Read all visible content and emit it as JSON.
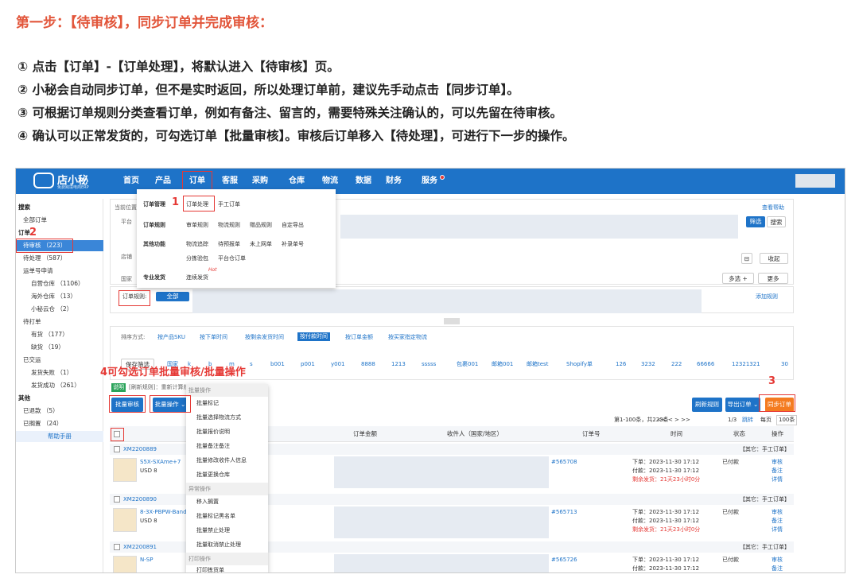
{
  "doc": {
    "title": "第一步：【待审核】，同步订单并完成审核：",
    "steps": [
      "① 点击【订单】-【订单处理】，将默认进入【待审核】页。",
      "② 小秘会自动同步订单，但不是实时返回，所以处理订单前，建议先手动点击【同步订单】。",
      "③ 可根据订单规则分类查看订单，例如有备注、留言的，需要特殊关注确认的，可以先留在待审核。",
      "④ 确认可以正常发货的，可勾选订单【批量审核】。审核后订单移入【待处理】，可进行下一步的操作。"
    ]
  },
  "app": {
    "logo_name": "店小秘",
    "logo_sub": "免费跨境电商ERP",
    "nav": [
      "首页",
      "产品",
      "订单",
      "客服",
      "采购",
      "仓库",
      "物流",
      "数据",
      "财务",
      "服务"
    ],
    "help_link": "查看帮助"
  },
  "sidebar": {
    "search": "搜索",
    "all_orders": "全部订单",
    "orders_head": "订单",
    "pending_review": "待审核 （223）",
    "pending_process": "待处理 （587）",
    "tracking_apply": "运单号申请",
    "own_wh": "自营仓库 （1106）",
    "overseas_wh": "海外仓库 （13）",
    "xiaomi_wh": "小秘云仓 （2）",
    "to_print": "待打单",
    "in_stock": "有货 （177）",
    "out_of_stock": "缺货 （19）",
    "shipped": "已交运",
    "ship_failed": "发货失败 （1）",
    "ship_success": "发货成功 （261）",
    "other_head": "其他",
    "refunded": "已退款 （5）",
    "on_hold": "已搁置 （24）",
    "help_manual": "帮助手册"
  },
  "dropdown": {
    "order_mgmt": "订单管理",
    "order_process": "订单处理",
    "manual_order": "手工订单",
    "order_rules": "订单规则",
    "rules": [
      "审单规则",
      "物流规则",
      "赠品规则",
      "自定导出"
    ],
    "other_funcs": "其他功能",
    "funcs": [
      "物流追踪",
      "待预报单",
      "未上网单",
      "补录单号",
      "分拣验包",
      "平台仓订单"
    ],
    "pro_ship": "专业发货",
    "continuous_ship": "连续发货",
    "hot": "Hot"
  },
  "filters": {
    "current_pos": "当前位置",
    "platform": "平台",
    "shop": "店铺",
    "country": "国家",
    "order_rule_label": "订单规则:",
    "order_rule_all": "全部 （223）",
    "add_rule": "添加规则",
    "filter_btn": "筛选",
    "search_btn": "搜索",
    "collapse": "收起",
    "multi_select": "多选 +",
    "more": "更多",
    "sort_label": "排序方式:",
    "sorts": [
      "按产品SKU",
      "按下单时间",
      "按剩余发货时间",
      "按付款时间",
      "按订单金额",
      "按买家指定物流"
    ],
    "save_filter": "保存筛选",
    "tags": [
      "国家",
      "k",
      "b",
      "m",
      "s",
      "b001",
      "p001",
      "y001",
      "8888",
      "1213",
      "sssss",
      "包裹001",
      "邮箱001",
      "邮箱test",
      "Shopify单",
      "126",
      "3232",
      "222",
      "66666",
      "12321321",
      "30"
    ],
    "notice_tag": "说明",
    "notice_text": "[刷新规则]：重新计算规则，并自动归入相应规则内"
  },
  "actions": {
    "bulk_review": "批量审核",
    "bulk_ops": "批量操作",
    "refresh_rules": "刷新规则",
    "export_orders": "导出订单",
    "sync_orders": "同步订单",
    "pagination": "第1-100条，共223条",
    "page_info": "1/3",
    "jump": "跳转",
    "per_page": "每页",
    "per_page_val": "100条"
  },
  "bulk_menu": {
    "g1": "批量操作",
    "g1_items": [
      "批量标记",
      "批量选择物流方式",
      "批量报价说明",
      "批量备注备注",
      "批量修改收件人信息",
      "批量更换仓库"
    ],
    "g2": "异常操作",
    "g2_items": [
      "移入搁置",
      "批量标记黑名单",
      "批量禁止处理",
      "批量取消禁止处理"
    ],
    "g3": "打印操作",
    "g3_items": [
      "打印拣货单"
    ]
  },
  "table": {
    "headers": [
      "订单金额",
      "收件人（国家/地区）",
      "订单号",
      "时间",
      "状态",
      "操作"
    ],
    "order_type": "【其它：手工订单】",
    "rows": [
      {
        "id": "XM2200889",
        "sku": "S5X-SXAme+7",
        "qty": "x",
        "price": "USD 8",
        "order_no": "#565708",
        "t1": "下单：2023-11-30 17:12",
        "t2": "付款：2023-11-30 17:12",
        "t3": "剩余发货：21天23小时0分",
        "status": "已付款",
        "ops": [
          "审核",
          "备注",
          "详情"
        ]
      },
      {
        "id": "XM2200890",
        "sku": "8-3X-PBPW-Band",
        "qty": "",
        "price": "USD 8",
        "order_no": "#565713",
        "t1": "下单：2023-11-30 17:12",
        "t2": "付款：2023-11-30 17:12",
        "t3": "剩余发货：21天23小时0分",
        "status": "已付款",
        "ops": [
          "审核",
          "备注",
          "详情"
        ]
      },
      {
        "id": "XM2200891",
        "sku": "N-SP",
        "qty": "x",
        "price": "",
        "order_no": "#565726",
        "t1": "下单：2023-11-30 17:12",
        "t2": "付款：2023-11-30 17:12",
        "t3": "",
        "status": "已付款",
        "ops": [
          "审核",
          "备注"
        ]
      }
    ]
  },
  "annotations": {
    "n1": "1",
    "n2": "2",
    "n3": "3",
    "n4": "4可勾选订单批量审核/批量操作"
  },
  "colors": {
    "brand_blue": "#1e73c8",
    "accent_red": "#e53935",
    "sync_orange": "#f47b20",
    "title_red": "#e2553a"
  }
}
